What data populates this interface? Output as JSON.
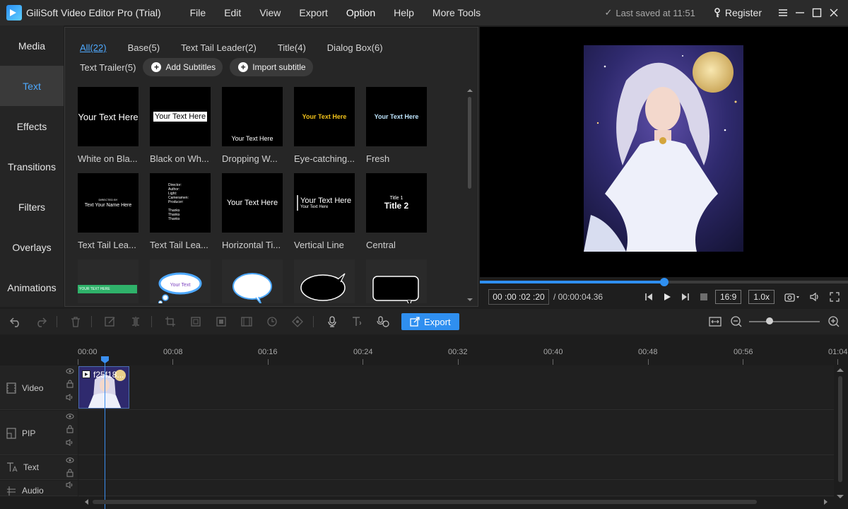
{
  "app": {
    "title": "GiliSoft Video Editor Pro (Trial)",
    "menu": [
      "File",
      "Edit",
      "View",
      "Export",
      "Option",
      "Help",
      "More Tools"
    ],
    "active_menu": "Option",
    "saved_status": "Last saved at 11:51",
    "register_label": "Register"
  },
  "sidebar": {
    "items": [
      {
        "label": "Media",
        "active": false
      },
      {
        "label": "Text",
        "active": true
      },
      {
        "label": "Effects",
        "active": false
      },
      {
        "label": "Transitions",
        "active": false
      },
      {
        "label": "Filters",
        "active": false
      },
      {
        "label": "Overlays",
        "active": false
      },
      {
        "label": "Animations",
        "active": false
      }
    ]
  },
  "library": {
    "categories": [
      "All(22)",
      "Base(5)",
      "Text Tail Leader(2)",
      "Title(4)",
      "Dialog Box(6)"
    ],
    "category_row2": "Text Trailer(5)",
    "add_subtitles": "Add Subtitles",
    "import_subtitle": "Import subtitle",
    "tiles": [
      {
        "label": "White on Bla...",
        "preview": "Your Text Here"
      },
      {
        "label": "Black on Wh...",
        "preview": "Your Text Here"
      },
      {
        "label": "Dropping W...",
        "preview": "Your Text Here"
      },
      {
        "label": "Eye-catching...",
        "preview": "Your Text Here"
      },
      {
        "label": "Fresh",
        "preview": "Your Text Here"
      },
      {
        "label": "Text Tail Lea...",
        "preview": "Text Your Name Here",
        "preview_small": "DIRECTED BY"
      },
      {
        "label": "Text Tail Lea...",
        "preview": "Director:\nAuthor:\nLight:\nCameramen:\nProducer:\n\nThanks\nThanks\nThanks"
      },
      {
        "label": "Horizontal Ti...",
        "preview": "Your Text Here"
      },
      {
        "label": "Vertical Line",
        "preview": "Your Text Here",
        "preview_small": "Your Text Here"
      },
      {
        "label": "Central",
        "preview": "Title 2",
        "preview_small": "Title 1"
      },
      {
        "label": "",
        "preview": "YOUR TEXT HERE"
      },
      {
        "label": "",
        "preview": "Your Text"
      },
      {
        "label": "",
        "preview": ""
      },
      {
        "label": "",
        "preview": ""
      },
      {
        "label": "",
        "preview": ""
      }
    ]
  },
  "player": {
    "current_time": "00 :00 :02 :20",
    "duration": "/ 00:00:04.36",
    "progress": 0.5,
    "aspect": "16:9",
    "speed": "1.0x"
  },
  "toolbar": {
    "export_label": "Export"
  },
  "timeline": {
    "ticks": [
      "00:00",
      "00:08",
      "00:16",
      "00:24",
      "00:32",
      "00:40",
      "00:48",
      "00:56",
      "01:04"
    ],
    "tracks": [
      {
        "name": "Video"
      },
      {
        "name": "PIP"
      },
      {
        "name": "Text"
      },
      {
        "name": "Audio"
      }
    ],
    "clip_name": "f25f18..."
  }
}
